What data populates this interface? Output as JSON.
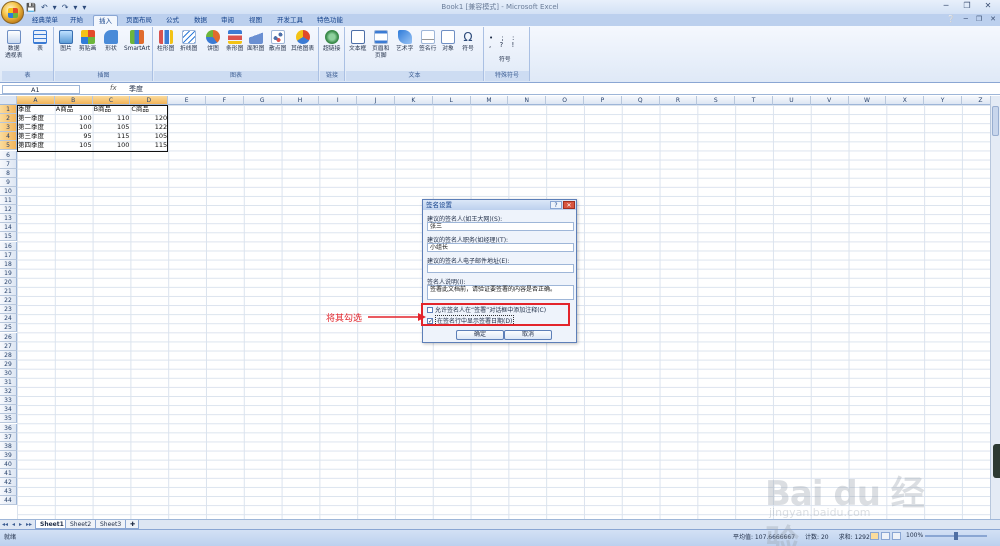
{
  "window": {
    "title": "Book1 [兼容模式] - Microsoft Excel",
    "quick_access": [
      "💾",
      "↶",
      "▾",
      "↷",
      "▾",
      "▾"
    ]
  },
  "tabs": [
    {
      "label": "经典菜单"
    },
    {
      "label": "开始"
    },
    {
      "label": "插入"
    },
    {
      "label": "页面布局"
    },
    {
      "label": "公式"
    },
    {
      "label": "数据"
    },
    {
      "label": "审阅"
    },
    {
      "label": "视图"
    },
    {
      "label": "开发工具"
    },
    {
      "label": "特色功能"
    }
  ],
  "ribbon": {
    "groups": [
      {
        "name": "表",
        "buttons": [
          "数据\n透视表",
          "表"
        ]
      },
      {
        "name": "插图",
        "buttons": [
          "图片",
          "剪贴画",
          "形状",
          "SmartArt"
        ]
      },
      {
        "name": "图表",
        "buttons": [
          "柱形图",
          "折线图",
          "饼图",
          "条形图",
          "面积图",
          "散点图",
          "其他图表"
        ]
      },
      {
        "name": "链接",
        "buttons": [
          "超链接"
        ]
      },
      {
        "name": "文本",
        "buttons": [
          "文本框",
          "页眉和\n页脚",
          "艺术字",
          "签名行",
          "对象",
          "符号"
        ]
      },
      {
        "name": "特殊符号",
        "buttons": [
          "符号"
        ]
      }
    ],
    "icon_colors": {
      "table": "#3b7bd4",
      "picture": "#5b9bd5",
      "shape": "#4a8bd8",
      "column": "#d9534f",
      "line": "#2f7bd9",
      "pie": "#e06b2d",
      "bar": "#3b7bd4",
      "area": "#6a8fd2",
      "scatter": "#4d6fa8",
      "other": "#e04a2a",
      "hyperlink": "#3a8a4a"
    }
  },
  "formula_bar": {
    "name_box": "A1",
    "fx": "fx",
    "value": "季度"
  },
  "columns": [
    "A",
    "B",
    "C",
    "D",
    "E",
    "F",
    "G",
    "H",
    "I",
    "J",
    "K",
    "L",
    "M",
    "N",
    "O",
    "P",
    "Q",
    "R",
    "S",
    "T",
    "U",
    "V",
    "W",
    "X",
    "Y",
    "Z"
  ],
  "rows": [
    "1",
    "2",
    "3",
    "4",
    "5",
    "6",
    "7",
    "8",
    "9",
    "10",
    "11",
    "12",
    "13",
    "14",
    "15",
    "16",
    "17",
    "18",
    "19",
    "20",
    "21",
    "22",
    "23",
    "24",
    "25",
    "26",
    "27",
    "28",
    "29",
    "30",
    "31",
    "32",
    "33",
    "34",
    "35",
    "36",
    "37",
    "38",
    "39",
    "40",
    "41",
    "42",
    "43",
    "44"
  ],
  "table": {
    "header": [
      "季度",
      "A商品",
      "B商品",
      "C商品"
    ],
    "rows": [
      [
        "第一季度",
        "100",
        "110",
        "120"
      ],
      [
        "第二季度",
        "100",
        "105",
        "122"
      ],
      [
        "第三季度",
        "95",
        "115",
        "105"
      ],
      [
        "第四季度",
        "105",
        "100",
        "115"
      ]
    ]
  },
  "dialog": {
    "title": "签名设置",
    "help": "?",
    "close": "✕",
    "signer_label": "建议的签名人(如王大网)(S):",
    "signer_value": "张三",
    "title_label": "建议的签名人职务(如经理)(T):",
    "title_value": "小组长",
    "email_label": "建议的签名人电子邮件地址(E):",
    "email_value": "",
    "instructions_label": "签名人说明(I):",
    "instructions_value": "签署此文档前，请验证要签署的内容是否正确。",
    "allow_comments": "允许签名人在“签署”对话框中添加注释(C)",
    "show_date": "在签名行中显示签署日期(D)",
    "show_date_checked": "✓",
    "ok": "确定",
    "cancel": "取消"
  },
  "annotation": {
    "text": "将其勾选",
    "color": "#e3242b"
  },
  "sheets": [
    "Sheet1",
    "Sheet2",
    "Sheet3"
  ],
  "sheet_nav": [
    "◂◂",
    "◂",
    "▸",
    "▸▸"
  ],
  "status": {
    "ready": "就绪",
    "average": "平均值: 107.6666667",
    "count": "计数: 20",
    "sum": "求和: 1292",
    "zoom": "100%"
  },
  "watermark": {
    "brand": "Bai du 经验",
    "url": "jingyan.baidu.com"
  }
}
